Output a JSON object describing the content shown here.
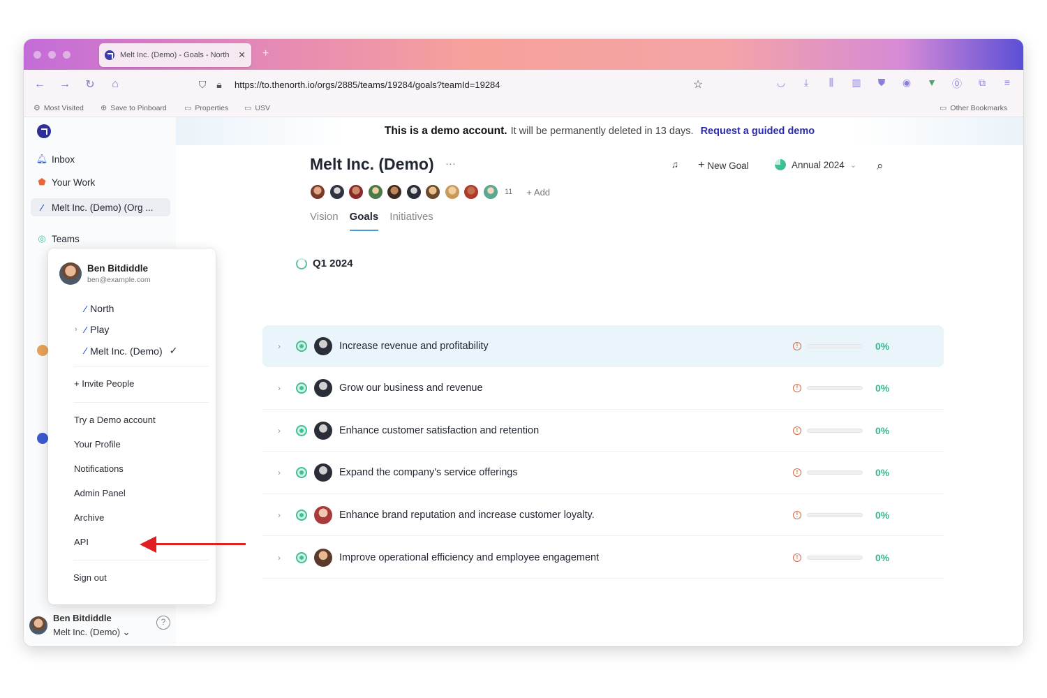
{
  "browser": {
    "tab_title": "Melt Inc. (Demo) - Goals - North",
    "url": "https://to.thenorth.io/orgs/2885/teams/19284/goals?teamId=19284",
    "bookmarks": [
      "Most Visited",
      "Save to Pinboard",
      "Properties",
      "USV"
    ],
    "other_bookmarks": "Other Bookmarks"
  },
  "banner": {
    "bold": "This is a demo account.",
    "text": "It will be permanently deleted in 13 days.",
    "link": "Request a guided demo"
  },
  "sidebar": {
    "items": [
      {
        "label": "Inbox",
        "icon": "bell-icon"
      },
      {
        "label": "Your Work",
        "icon": "your-work-icon"
      },
      {
        "label": "Melt Inc. (Demo) (Org ...",
        "icon": "bolt-icon"
      }
    ],
    "teams_label": "Teams",
    "footer": {
      "name": "Ben Bitdiddle",
      "org": "Melt Inc. (Demo) ⌄"
    }
  },
  "menu": {
    "name": "Ben Bitdiddle",
    "email": "ben@example.com",
    "orgs": [
      "North",
      "Play",
      "Melt Inc. (Demo)"
    ],
    "invite": "+ Invite People",
    "items": [
      "Try a Demo account",
      "Your Profile",
      "Notifications",
      "Admin Panel",
      "Archive",
      "API"
    ],
    "signout": "Sign out"
  },
  "main": {
    "title": "Melt Inc. (Demo)",
    "more": "···",
    "new_goal": "New Goal",
    "period": "Annual 2024",
    "member_count": "11",
    "add": "+ Add",
    "tabs": [
      "Vision",
      "Goals",
      "Initiatives"
    ],
    "active_tab": "Goals",
    "quarter": "Q1 2024"
  },
  "goals": [
    {
      "title": "Increase revenue and profitability",
      "progress": 0,
      "pct": "0%"
    },
    {
      "title": "Grow our business and revenue",
      "progress": 0,
      "pct": "0%"
    },
    {
      "title": "Enhance customer satisfaction and retention",
      "progress": 0,
      "pct": "0%"
    },
    {
      "title": "Expand the company's service offerings",
      "progress": 0,
      "pct": "0%"
    },
    {
      "title": "Enhance brand reputation and increase customer loyalty.",
      "progress": 0,
      "pct": "0%"
    },
    {
      "title": "Improve operational efficiency and employee engagement",
      "progress": 0,
      "pct": "0%"
    }
  ],
  "colors": {
    "accent": "#2a2ab0",
    "success": "#35b88c",
    "warning": "#d9643a",
    "annotation_arrow": "#e02020"
  }
}
